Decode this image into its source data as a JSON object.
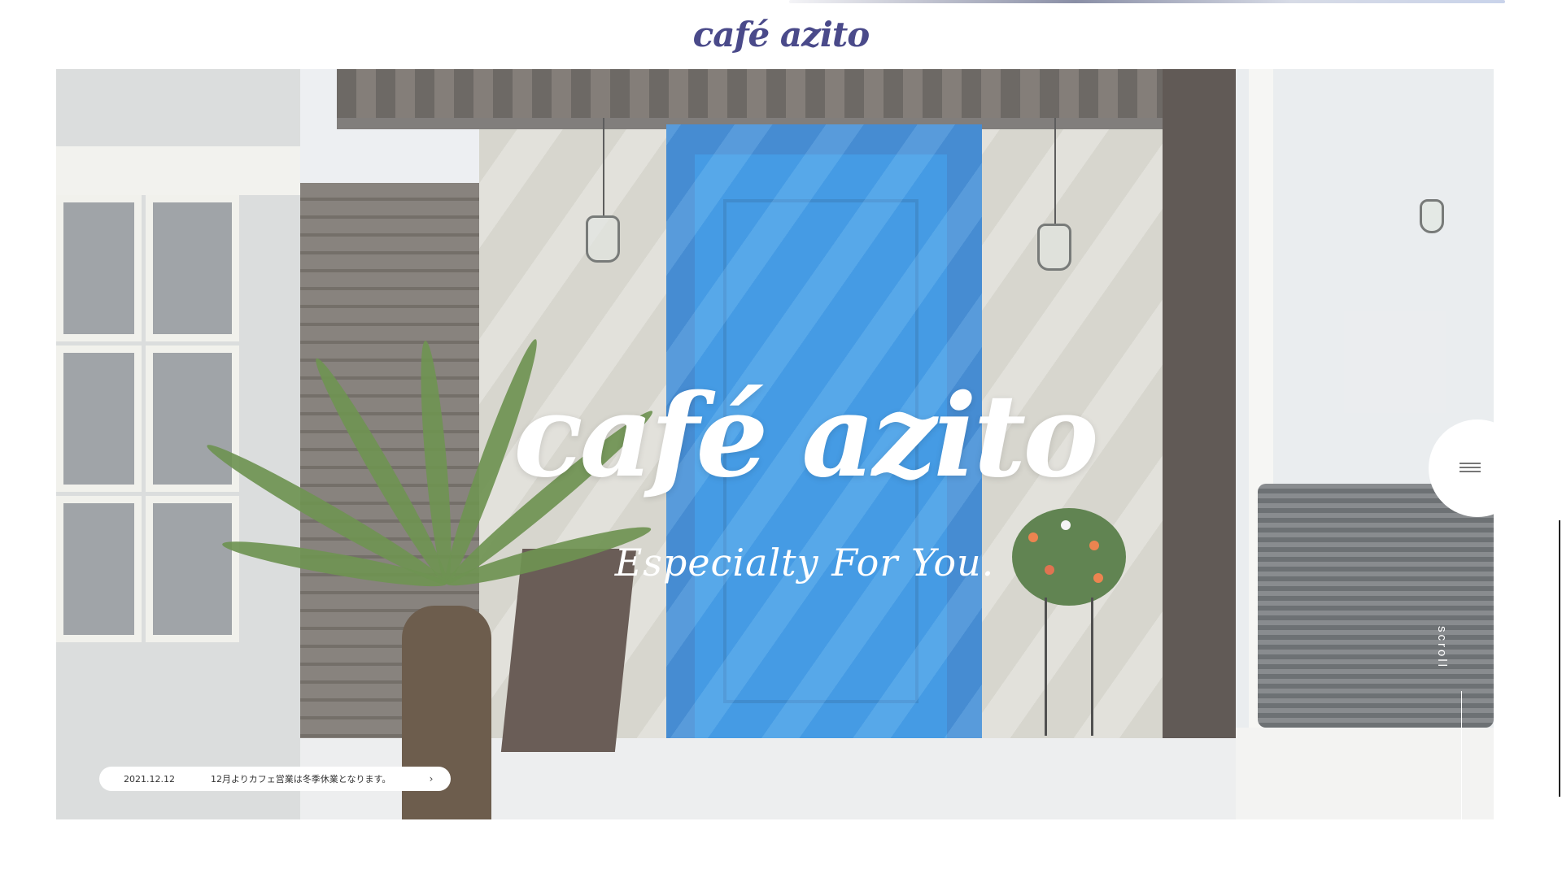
{
  "header": {
    "logo_text": "café azito"
  },
  "hero": {
    "title": "café azito",
    "subtitle": "Especialty For You."
  },
  "news": {
    "date": "2021.12.12",
    "text": "12月よりカフェ営業は冬季休業となります。",
    "arrow_icon": "chevron-right-icon"
  },
  "menu": {
    "icon": "hamburger-icon"
  },
  "scroll": {
    "label": "scroll"
  },
  "colors": {
    "logo": "#4a4a8a",
    "door_blue": "#1d86de",
    "background": "#ffffff"
  }
}
